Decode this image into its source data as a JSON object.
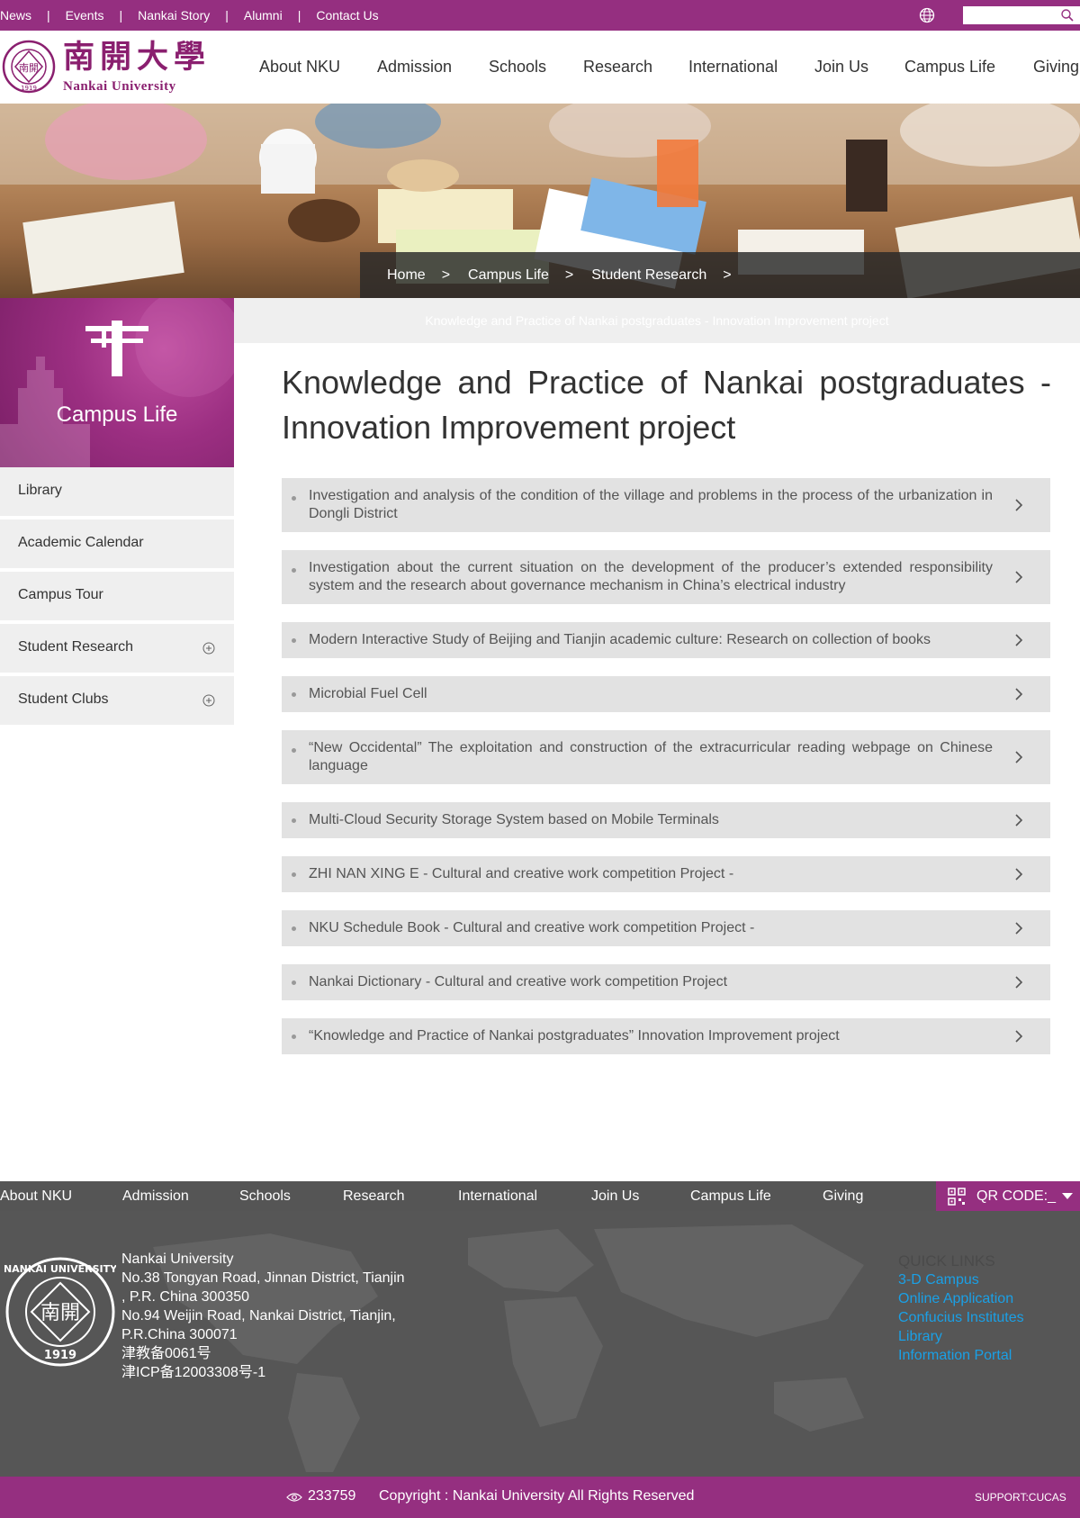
{
  "topbar": {
    "links": [
      "News",
      "Events",
      "Nankai Story",
      "Alumni",
      "Contact Us"
    ],
    "separator": "|",
    "search_placeholder": "",
    "globe_icon": "globe-icon",
    "search_icon": "search-icon",
    "color": "#952f80"
  },
  "logo": {
    "chinese": "南開大學",
    "english": "Nankai University",
    "seal_text": "NANKAI UNIVERSITY",
    "seal_year": "1919",
    "seal_char": "南開"
  },
  "main_nav": [
    "About NKU",
    "Admission",
    "Schools",
    "Research",
    "International",
    "Join Us",
    "Campus Life",
    "Giving"
  ],
  "breadcrumb": [
    "Home",
    "Campus Life",
    "Student Research"
  ],
  "breadcrumb_separator": ">",
  "sidebar": {
    "title": "Campus Life",
    "items": [
      {
        "label": "Library",
        "expandable": false
      },
      {
        "label": "Academic Calendar",
        "expandable": false
      },
      {
        "label": "Campus Tour",
        "expandable": false
      },
      {
        "label": "Student Research",
        "expandable": true
      },
      {
        "label": "Student Clubs",
        "expandable": true
      }
    ]
  },
  "content": {
    "sub_bar_text": "Knowledge and Practice of Nankai postgraduates - Innovation Improvement project",
    "title": "Knowledge and Practice of Nankai postgraduates - Innovation Improvement project",
    "items": [
      "Investigation and analysis of the condition of the village and problems in the process of the urbanization in Dongli District",
      "Investigation about the current situation on the development of the producer’s extended responsibility system and the research about governance mechanism in China’s electrical industry",
      "Modern Interactive Study of Beijing and Tianjin academic culture: Research on collection of books",
      "Microbial Fuel Cell",
      "“New Occidental” The exploitation and construction of the extracurricular reading webpage on Chinese language",
      "Multi-Cloud Security Storage System based on Mobile Terminals",
      "ZHI NAN XING E - Cultural and creative work competition Project -",
      "NKU Schedule Book - Cultural and creative work competition Project -",
      "Nankai Dictionary - Cultural and creative work competition Project",
      "“Knowledge and Practice of Nankai postgraduates” Innovation Improvement project"
    ]
  },
  "footer": {
    "nav": [
      "About NKU",
      "Admission",
      "Schools",
      "Research",
      "International",
      "Join Us",
      "Campus Life",
      "Giving"
    ],
    "qr_label": "QR CODE:_",
    "address_lines": [
      "Nankai University",
      "No.38 Tongyan Road, Jinnan District, Tianjin",
      ", P.R. China 300350",
      "No.94 Weijin Road,  Nankai District, Tianjin,",
      "P.R.China  300071",
      "津教备0061号",
      "津ICP备12003308号-1"
    ],
    "quick_links_title": "QUICK LINKS",
    "quick_links": [
      "3-D Campus",
      "Online Application",
      "Confucius Institutes",
      "Library",
      "Information Portal"
    ],
    "visits": "233759",
    "copyright": "Copyright : Nankai University All Rights Reserved",
    "support": "SUPPORT:CUCAS"
  }
}
